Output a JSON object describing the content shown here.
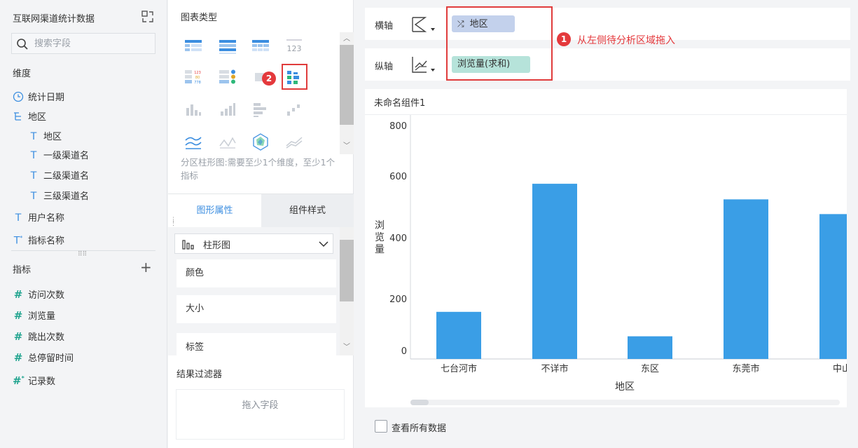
{
  "dataset": {
    "title": "互联网渠道统计数据",
    "search_placeholder": "搜索字段"
  },
  "dimensions": {
    "section_title": "维度",
    "fields": [
      {
        "label": "统计日期",
        "icon": "clock-icon"
      },
      {
        "label": "地区",
        "icon": "tree-icon"
      },
      {
        "label": "地区",
        "icon": "text-icon"
      },
      {
        "label": "一级渠道名",
        "icon": "text-icon"
      },
      {
        "label": "二级渠道名",
        "icon": "text-icon"
      },
      {
        "label": "三级渠道名",
        "icon": "text-icon"
      },
      {
        "label": "用户名称",
        "icon": "text-icon"
      },
      {
        "label": "指标名称",
        "icon": "text-calc-icon"
      }
    ]
  },
  "metrics": {
    "section_title": "指标",
    "fields": [
      {
        "label": "访问次数",
        "icon": "hash-icon"
      },
      {
        "label": "浏览量",
        "icon": "hash-icon"
      },
      {
        "label": "跳出次数",
        "icon": "hash-icon"
      },
      {
        "label": "总停留时间",
        "icon": "hash-icon"
      },
      {
        "label": "记录数",
        "icon": "hash-calc-icon"
      }
    ]
  },
  "chart_types": {
    "title": "图表类型",
    "description": "分区柱形图:需要至少1个维度，至少1个指标",
    "badge": "2"
  },
  "tabs": {
    "properties": "图形属性",
    "component_style": "组件样式"
  },
  "properties": {
    "chart_type_selected": "柱形图",
    "rows": [
      "颜色",
      "大小",
      "标签"
    ]
  },
  "filter": {
    "title": "结果过滤器",
    "drop_hint": "拖入字段"
  },
  "axes": {
    "x_label": "横轴",
    "x_field": "地区",
    "y_label": "纵轴",
    "y_field": "浏览量(求和)",
    "badge": "1",
    "hint": "从左侧待分析区域拖入"
  },
  "widget": {
    "title": "未命名组件1"
  },
  "view_all": "查看所有数据",
  "colors": {
    "bar": "#3a9ee6",
    "accent": "#3c8ee0",
    "highlight_red": "#e4393c",
    "pill_x": "#c3d1ec",
    "pill_y": "#b6e3da"
  },
  "chart_data": {
    "type": "bar",
    "categories": [
      "七台河市",
      "不详市",
      "东区",
      "东莞市",
      "中山"
    ],
    "values": [
      160,
      595,
      77,
      542,
      492
    ],
    "xlabel": "地区",
    "ylabel": "浏览量",
    "ylim": [
      0,
      800
    ],
    "yticks": [
      0,
      200,
      400,
      600,
      800
    ],
    "grid": false,
    "legend": "none"
  }
}
